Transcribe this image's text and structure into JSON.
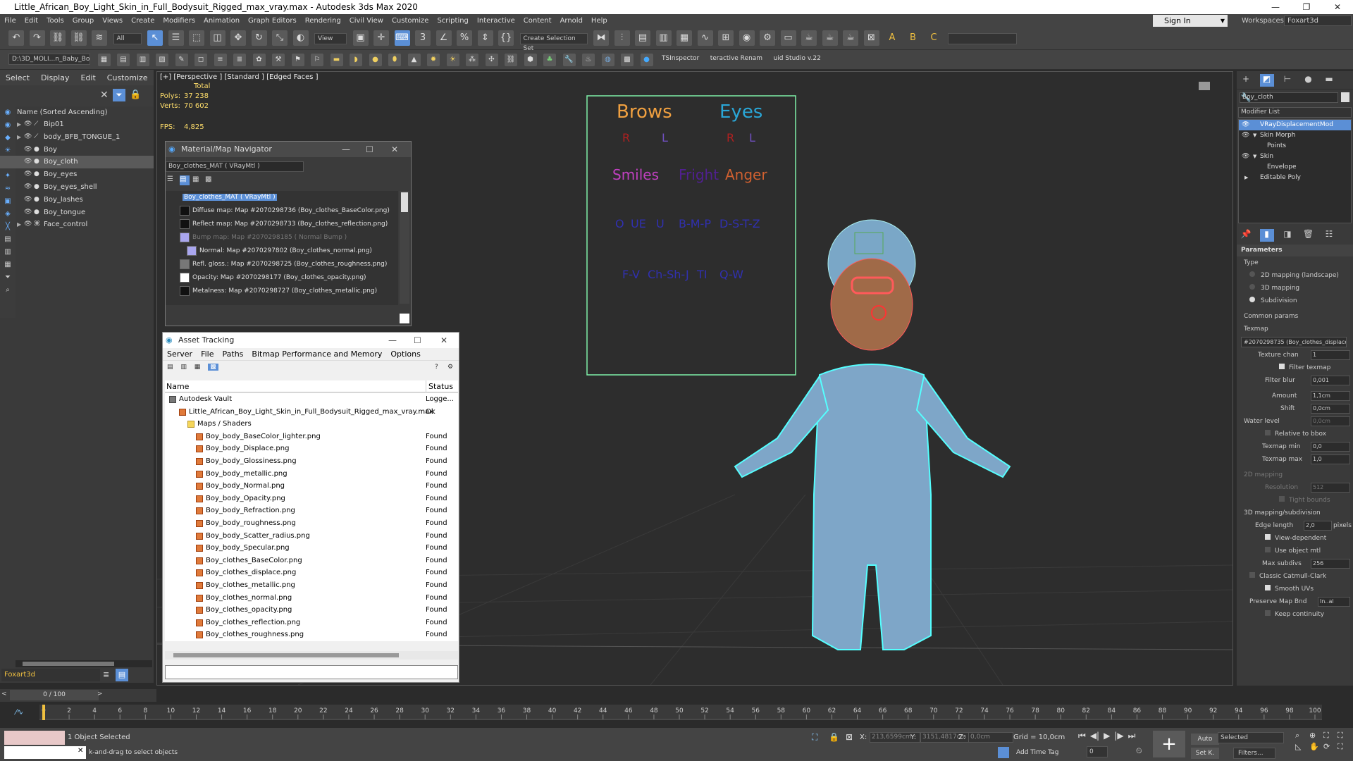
{
  "window": {
    "title": "Little_African_Boy_Light_Skin_in_Full_Bodysuit_Rigged_max_vray.max - Autodesk 3ds Max 2020",
    "buttons": [
      "—",
      "❐",
      "✕"
    ]
  },
  "menu": [
    "File",
    "Edit",
    "Tools",
    "Group",
    "Views",
    "Create",
    "Modifiers",
    "Animation",
    "Graph Editors",
    "Rendering",
    "Civil View",
    "Customize",
    "Scripting",
    "Interactive",
    "Content",
    "Arnold",
    "Help"
  ],
  "signin": {
    "label": "Sign In"
  },
  "workspaces": {
    "label": "Workspaces:",
    "value": "Foxart3d"
  },
  "toolbar": {
    "filter_all": "All",
    "view_dropdown": "View",
    "selection_set": "Create Selection Set",
    "path": "D:\\3D_MOLI...n_Baby_Bo",
    "tsinspector": "TSInspector",
    "rename": "teractive Renam",
    "studio": "uid Studio v.22"
  },
  "scene_explorer": {
    "tabs": [
      "Select",
      "Display",
      "Edit",
      "Customize"
    ],
    "header": "Name (Sorted Ascending)",
    "items": [
      {
        "name": "Bip01",
        "expandable": true,
        "selected": false
      },
      {
        "name": "body_BFB_TONGUE_1",
        "expandable": true,
        "selected": false
      },
      {
        "name": "Boy",
        "expandable": false,
        "selected": false
      },
      {
        "name": "Boy_cloth",
        "expandable": false,
        "selected": true
      },
      {
        "name": "Boy_eyes",
        "expandable": false,
        "selected": false
      },
      {
        "name": "Boy_eyes_shell",
        "expandable": false,
        "selected": false
      },
      {
        "name": "Boy_lashes",
        "expandable": false,
        "selected": false
      },
      {
        "name": "Boy_tongue",
        "expandable": false,
        "selected": false
      },
      {
        "name": "Face_control",
        "expandable": true,
        "selected": false
      }
    ],
    "layer": "Foxart3d",
    "frame_counter": "0 / 100"
  },
  "viewport": {
    "label": "[+] [Perspective ] [Standard ] [Edged Faces ]",
    "stats_total": "Total",
    "polys_label": "Polys:",
    "polys_value": "37 238",
    "verts_label": "Verts:",
    "verts_value": "70 602",
    "fps_label": "FPS:",
    "fps_value": "4,825",
    "face_board": {
      "brows": "Brows",
      "eyes": "Eyes",
      "r1": "R",
      "l1": "L",
      "r2": "R",
      "l2": "L",
      "smiles": "Smiles",
      "fright": "Fright",
      "anger": "Anger",
      "row3": [
        "O",
        "UE",
        "U",
        "B-M-P",
        "D-S-T-Z"
      ],
      "row4": [
        "F-V",
        "Ch-Sh-J",
        "TI",
        "Q-W"
      ]
    }
  },
  "material_navigator": {
    "title": "Material/Map Navigator",
    "field": "Boy_clothes_MAT  ( VRayMtl )",
    "root": "Boy_clothes_MAT  ( VRayMtl )",
    "maps": [
      {
        "label": "Diffuse map: Map #2070298736 (Boy_clothes_BaseColor.png)",
        "dim": false
      },
      {
        "label": "Reflect map: Map #2070298733 (Boy_clothes_reflection.png)",
        "dim": false
      },
      {
        "label": "Bump map: Map #2070298185  ( Normal Bump )",
        "dim": true
      },
      {
        "label": "Normal: Map #2070297802 (Boy_clothes_normal.png)",
        "dim": false
      },
      {
        "label": "Refl. gloss.: Map #2070298725 (Boy_clothes_roughness.png)",
        "dim": false
      },
      {
        "label": "Opacity: Map #2070298177 (Boy_clothes_opacity.png)",
        "dim": false
      },
      {
        "label": "Metalness: Map #2070298727 (Boy_clothes_metallic.png)",
        "dim": false
      }
    ]
  },
  "asset_tracking": {
    "title": "Asset Tracking",
    "menu": [
      "Server",
      "File",
      "Paths",
      "Bitmap Performance and Memory",
      "Options"
    ],
    "col_name": "Name",
    "col_status": "Status",
    "rows": [
      {
        "name": "Autodesk Vault",
        "status": "Logge...",
        "level": 0,
        "type": "vault"
      },
      {
        "name": "Little_African_Boy_Light_Skin_in_Full_Bodysuit_Rigged_max_vray.max",
        "status": "Ok",
        "level": 1,
        "type": "file"
      },
      {
        "name": "Maps / Shaders",
        "status": "",
        "level": 2,
        "type": "folder"
      },
      {
        "name": "Boy_body_BaseColor_lighter.png",
        "status": "Found",
        "level": 3,
        "type": "map"
      },
      {
        "name": "Boy_body_Displace.png",
        "status": "Found",
        "level": 3,
        "type": "map"
      },
      {
        "name": "Boy_body_Glossiness.png",
        "status": "Found",
        "level": 3,
        "type": "map"
      },
      {
        "name": "Boy_body_metallic.png",
        "status": "Found",
        "level": 3,
        "type": "map"
      },
      {
        "name": "Boy_body_Normal.png",
        "status": "Found",
        "level": 3,
        "type": "map"
      },
      {
        "name": "Boy_body_Opacity.png",
        "status": "Found",
        "level": 3,
        "type": "map"
      },
      {
        "name": "Boy_body_Refraction.png",
        "status": "Found",
        "level": 3,
        "type": "map"
      },
      {
        "name": "Boy_body_roughness.png",
        "status": "Found",
        "level": 3,
        "type": "map"
      },
      {
        "name": "Boy_body_Scatter_radius.png",
        "status": "Found",
        "level": 3,
        "type": "map"
      },
      {
        "name": "Boy_body_Specular.png",
        "status": "Found",
        "level": 3,
        "type": "map"
      },
      {
        "name": "Boy_clothes_BaseColor.png",
        "status": "Found",
        "level": 3,
        "type": "map"
      },
      {
        "name": "Boy_clothes_displace.png",
        "status": "Found",
        "level": 3,
        "type": "map"
      },
      {
        "name": "Boy_clothes_metallic.png",
        "status": "Found",
        "level": 3,
        "type": "map"
      },
      {
        "name": "Boy_clothes_normal.png",
        "status": "Found",
        "level": 3,
        "type": "map"
      },
      {
        "name": "Boy_clothes_opacity.png",
        "status": "Found",
        "level": 3,
        "type": "map"
      },
      {
        "name": "Boy_clothes_reflection.png",
        "status": "Found",
        "level": 3,
        "type": "map"
      },
      {
        "name": "Boy_clothes_roughness.png",
        "status": "Found",
        "level": 3,
        "type": "map"
      }
    ]
  },
  "command_panel": {
    "object_name": "Boy_cloth",
    "modifier_list": "Modifier List",
    "stack": [
      {
        "label": "VRayDisplacementMod",
        "selected": true,
        "indent": 0
      },
      {
        "label": "Skin Morph",
        "selected": false,
        "indent": 0
      },
      {
        "label": "Points",
        "selected": false,
        "indent": 1
      },
      {
        "label": "Skin",
        "selected": false,
        "indent": 0
      },
      {
        "label": "Envelope",
        "selected": false,
        "indent": 1
      },
      {
        "label": "Editable Poly",
        "selected": false,
        "indent": 0
      }
    ],
    "parameters": "Parameters",
    "type_label": "Type",
    "type_options": [
      {
        "label": "2D mapping (landscape)",
        "on": false
      },
      {
        "label": "3D mapping",
        "on": false
      },
      {
        "label": "Subdivision",
        "on": true
      }
    ],
    "common_params": "Common params",
    "texmap_label": "Texmap",
    "texmap_value": "#2070298735 (Boy_clothes_displace",
    "texture_chan": {
      "label": "Texture chan",
      "value": "1"
    },
    "filter_texmap": "Filter texmap",
    "filter_blur": {
      "label": "Filter blur",
      "value": "0,001"
    },
    "amount": {
      "label": "Amount",
      "value": "1,1cm"
    },
    "shift": {
      "label": "Shift",
      "value": "0,0cm"
    },
    "water_level": {
      "label": "Water level",
      "value": "0,0cm"
    },
    "relative_bbox": "Relative to bbox",
    "texmap_min": {
      "label": "Texmap min",
      "value": "0,0"
    },
    "texmap_max": {
      "label": "Texmap max",
      "value": "1,0"
    },
    "mapping_2d": "2D mapping",
    "resolution": {
      "label": "Resolution",
      "value": "512"
    },
    "tight_bounds": "Tight bounds",
    "mapping_3d": "3D mapping/subdivision",
    "edge_length": {
      "label": "Edge length",
      "value": "2,0",
      "unit": "pixels"
    },
    "view_dependent": "View-dependent",
    "use_object_mtl": "Use object mtl",
    "max_subdivs": {
      "label": "Max subdivs",
      "value": "256"
    },
    "classic_catmull": "Classic Catmull-Clark",
    "smooth_uvs": "Smooth UVs",
    "preserve_map": {
      "label": "Preserve Map Bnd",
      "value": "In..al"
    },
    "keep_continuity": "Keep continuity"
  },
  "timeline": {
    "ticks": [
      "0",
      "2",
      "4",
      "6",
      "8",
      "10",
      "12",
      "14",
      "16",
      "18",
      "20",
      "22",
      "24",
      "26",
      "28",
      "30",
      "32",
      "34",
      "36",
      "38",
      "40",
      "42",
      "44",
      "46",
      "48",
      "50",
      "52",
      "54",
      "56",
      "58",
      "60",
      "62",
      "64",
      "66",
      "68",
      "70",
      "72",
      "74",
      "76",
      "78",
      "80",
      "82",
      "84",
      "86",
      "88",
      "90",
      "92",
      "94",
      "96",
      "98",
      "100"
    ]
  },
  "status": {
    "selected": "1 Object Selected",
    "hint": "k-and-drag to select objects",
    "x_label": "X:",
    "x_value": "213,6599cm",
    "y_label": "Y:",
    "y_value": "3151,4817cm",
    "z_label": "Z:",
    "z_value": "0,0cm",
    "grid": "Grid = 10,0cm",
    "add_time_tag": "Add Time Tag",
    "auto": "Auto",
    "selected_dd": "Selected",
    "set_k": "Set K.",
    "filters": "Filters...",
    "frame": "0"
  }
}
